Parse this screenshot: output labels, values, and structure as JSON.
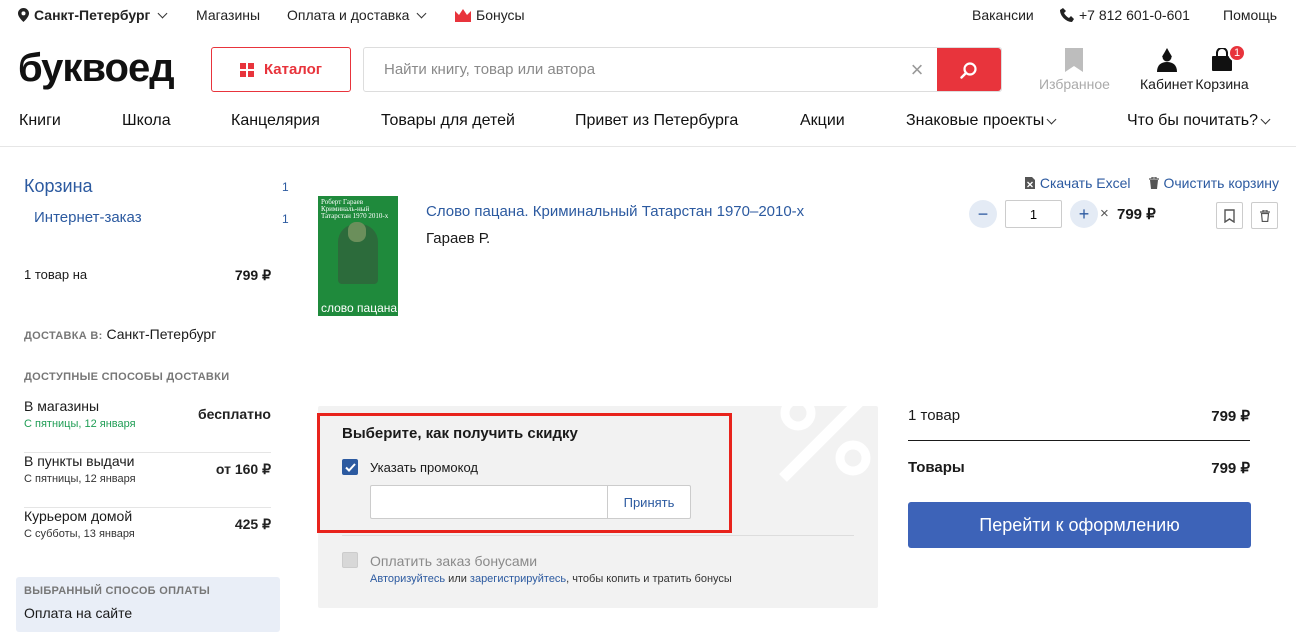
{
  "topbar": {
    "city": "Санкт-Петербург",
    "stores": "Магазины",
    "payment_delivery": "Оплата и доставка",
    "bonuses": "Бонусы",
    "vacancies": "Вакансии",
    "phone": "+7 812 601-0-601",
    "help": "Помощь"
  },
  "header": {
    "logo": "буквоед",
    "catalog": "Каталог",
    "search_placeholder": "Найти книгу, товар или автора",
    "favorites": "Избранное",
    "cabinet": "Кабинет",
    "cart": "Корзина",
    "cart_count": "1"
  },
  "nav": {
    "items": [
      "Книги",
      "Школа",
      "Канцелярия",
      "Товары для детей",
      "Привет из Петербурга",
      "Акции",
      "Знаковые проекты",
      "Что бы почитать?"
    ]
  },
  "sidebar": {
    "cart_title": "Корзина",
    "cart_count": "1",
    "online_order": "Интернет-заказ",
    "online_count": "1",
    "summary_label": "1 товар на",
    "summary_price": "799 ₽",
    "delivery_to_label": "Доставка в:",
    "delivery_city": "Санкт-Петербург",
    "methods_heading": "Доступные способы доставки",
    "methods": [
      {
        "title": "В магазины",
        "date": "С пятницы, 12 января",
        "price": "бесплатно"
      },
      {
        "title": "В пункты выдачи",
        "date": "С пятницы, 12 января",
        "price": "от 160 ₽"
      },
      {
        "title": "Курьером домой",
        "date": "С субботы, 13 января",
        "price": "425 ₽"
      }
    ],
    "payment_heading": "Выбранный способ оплаты",
    "payment_value": "Оплата на сайте"
  },
  "product": {
    "download_excel": "Скачать Excel",
    "clear_cart": "Очистить корзину",
    "cover_top_left": "Роберт Гараев",
    "cover_top_mid": "Криминаль-ный Татарстан 1970 2010-х",
    "cover_bottom": "слово пацана",
    "title": "Слово пацана. Криминальный Татарстан 1970–2010-х",
    "author": "Гараев Р.",
    "quantity": "1",
    "minus": "−",
    "plus": "+",
    "times": "×",
    "price": "799 ₽"
  },
  "discount": {
    "heading": "Выберите, как получить скидку",
    "promo_label": "Указать промокод",
    "promo_checked": true,
    "promo_value": "",
    "accept": "Принять",
    "bonus_label": "Оплатить заказ бонусами",
    "bonus_checked": false,
    "bonus_login": "Авторизуйтесь",
    "bonus_or": "или",
    "bonus_register": "зарегистрируйтесь",
    "bonus_tail": ", чтобы копить и тратить бонусы"
  },
  "totals": {
    "items_label": "1 товар",
    "items_value": "799 ₽",
    "goods_label": "Товары",
    "goods_value": "799 ₽",
    "checkout": "Перейти к оформлению"
  },
  "colors": {
    "brand_red": "#e8343c",
    "link_blue": "#2c5aa0",
    "checkout_blue": "#3d63b8",
    "highlight": "#e8231c"
  }
}
